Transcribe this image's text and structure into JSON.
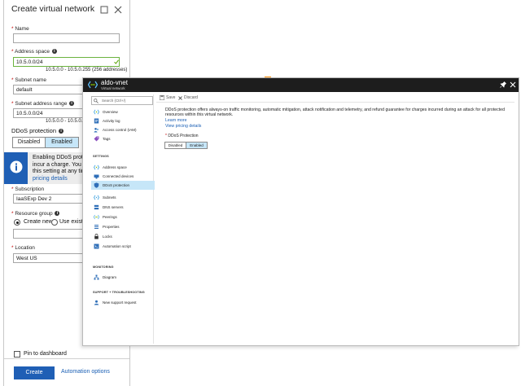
{
  "left_blade": {
    "title": "Create virtual network",
    "name_label": "Name",
    "name_value": "",
    "address_space_label": "Address space",
    "address_space_value": "10.5.0.0/24",
    "address_space_range": "10.5.0.0 - 10.5.0.255 (256 addresses)",
    "subnet_name_label": "Subnet name",
    "subnet_name_value": "default",
    "subnet_range_label": "Subnet address range",
    "subnet_range_value": "10.5.0.0/24",
    "subnet_range_hint": "10.5.0.0 - 10.5.0.255",
    "ddos_label": "DDoS protection",
    "ddos_options": [
      "Disabled",
      "Enabled"
    ],
    "ddos_selected": "Enabled",
    "info_lines": [
      "Enabling DDoS prote",
      "incur a charge. You ca",
      "this setting at any tim"
    ],
    "info_link": "pricing details",
    "subscription_label": "Subscription",
    "subscription_value": "IaaSExp Dev 2",
    "resource_group_label": "Resource group",
    "rg_create_new": "Create new",
    "rg_use_existing": "Use existing",
    "location_label": "Location",
    "location_value": "West US",
    "pin_label": "Pin to dashboard",
    "create_button": "Create",
    "automation_link": "Automation options",
    "accent_green": "#57a300",
    "brand_blue": "#1f5fb5"
  },
  "right_blade": {
    "title": "aldo-vnet",
    "subtitle": "Virtual network",
    "search_placeholder": "Search (Ctrl+/)",
    "menu_top": [
      {
        "label": "Overview",
        "icon": "vnet-icon"
      },
      {
        "label": "Activity log",
        "icon": "activity-log-icon"
      },
      {
        "label": "Access control (IAM)",
        "icon": "iam-icon"
      },
      {
        "label": "Tags",
        "icon": "tag-icon"
      }
    ],
    "settings_header": "SETTINGS",
    "menu_settings": [
      {
        "label": "Address space",
        "icon": "address-space-icon"
      },
      {
        "label": "Connected devices",
        "icon": "connected-devices-icon"
      },
      {
        "label": "DDoS protection",
        "icon": "shield-icon",
        "selected": true
      },
      {
        "label": "Subnets",
        "icon": "subnets-icon"
      },
      {
        "label": "DNS servers",
        "icon": "dns-icon"
      },
      {
        "label": "Peerings",
        "icon": "peerings-icon"
      },
      {
        "label": "Properties",
        "icon": "properties-icon"
      },
      {
        "label": "Locks",
        "icon": "lock-icon"
      },
      {
        "label": "Automation script",
        "icon": "script-icon"
      }
    ],
    "monitoring_header": "MONITORING",
    "menu_monitoring": [
      {
        "label": "Diagram",
        "icon": "diagram-icon"
      }
    ],
    "support_header": "SUPPORT + TROUBLESHOOTING",
    "menu_support": [
      {
        "label": "New support request",
        "icon": "support-icon"
      }
    ],
    "save_label": "Save",
    "discard_label": "Discard",
    "description": "DDoS protection offers always-on traffic monitoring, automatic mitigation, attack notification and telemetry, and refund guarantee for charges incurred during an attack for all protected resources within this virtual network.",
    "learn_more": "Learn more",
    "pricing_link": "View pricing details",
    "ddos_label": "DDoS Protection",
    "ddos_options": [
      "Disabled",
      "Enabled"
    ],
    "ddos_selected": "Enabled",
    "accent_orange": "#ff8c00",
    "selected_bg": "#c6e6f8"
  }
}
